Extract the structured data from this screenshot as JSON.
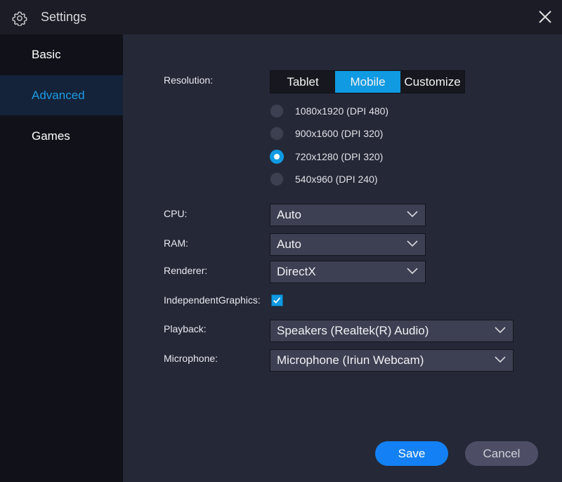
{
  "window": {
    "title": "Settings"
  },
  "sidebar": {
    "items": [
      {
        "label": "Basic",
        "active": false
      },
      {
        "label": "Advanced",
        "active": true
      },
      {
        "label": "Games",
        "active": false
      }
    ]
  },
  "resolution": {
    "label": "Resolution:",
    "tabs": [
      "Tablet",
      "Mobile",
      "Customize"
    ],
    "selected_tab": "Mobile",
    "options": [
      {
        "label": "1080x1920 (DPI 480)",
        "selected": false
      },
      {
        "label": "900x1600 (DPI 320)",
        "selected": false
      },
      {
        "label": "720x1280 (DPI 320)",
        "selected": true
      },
      {
        "label": "540x960 (DPI 240)",
        "selected": false
      }
    ]
  },
  "cpu": {
    "label": "CPU:",
    "value": "Auto"
  },
  "ram": {
    "label": "RAM:",
    "value": "Auto"
  },
  "renderer": {
    "label": "Renderer:",
    "value": "DirectX"
  },
  "independent_graphics": {
    "label": "IndependentGraphics:",
    "checked": true
  },
  "playback": {
    "label": "Playback:",
    "value": "Speakers (Realtek(R) Audio)"
  },
  "microphone": {
    "label": "Microphone:",
    "value": "Microphone (Iriun Webcam)"
  },
  "buttons": {
    "save": "Save",
    "cancel": "Cancel"
  },
  "colors": {
    "accent": "#0f9ae2",
    "save": "#1381f5"
  }
}
